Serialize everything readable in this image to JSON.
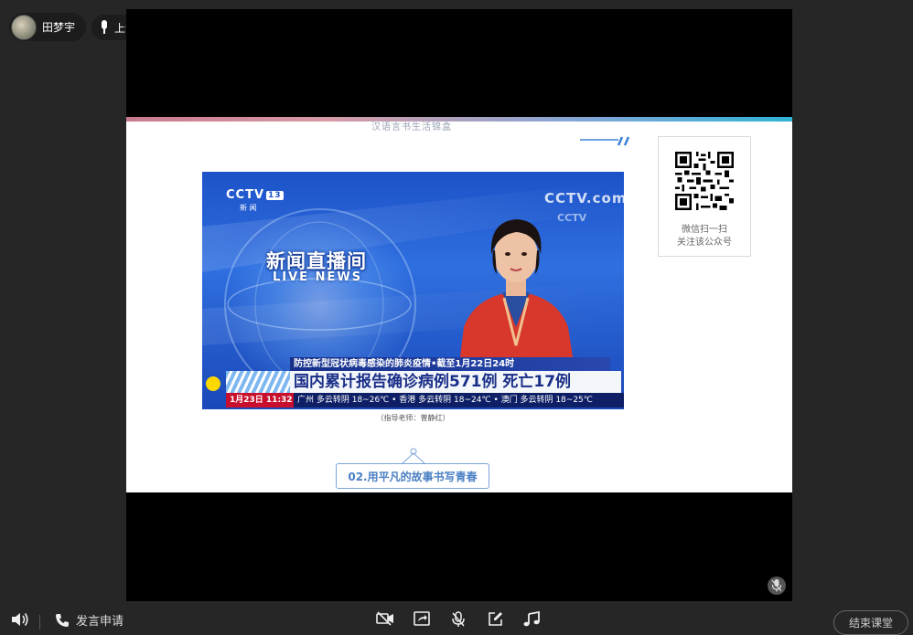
{
  "user": {
    "name": "田梦宇"
  },
  "status": {
    "label": "上课中"
  },
  "slide": {
    "cut_heading": "汉语言书生活锦盒",
    "qr": {
      "line1": "微信扫一扫",
      "line2": "关注该公众号"
    },
    "video": {
      "channel_logo": "CCTV",
      "channel_number": "13",
      "channel_sub": "新 闻",
      "program_title": "新闻直播间",
      "program_subtitle": "LIVE NEWS",
      "watermark": "CCTV.com",
      "watermark2": "CCTV",
      "ticker_top": "防控新型冠状病毒感染的肺炎疫情•截至1月22日24时",
      "ticker_main": "国内累计报告确诊病例571例 死亡17例",
      "ticker_date": "1月23日 11:32",
      "ticker_weather": "广州 多云转阴 18~26℃ • 香港 多云转阴 18~24℃ • 澳门 多云转阴 18~25℃"
    },
    "video_caption": "（指导老师：曾静红）",
    "section_tag": "02.用平凡的故事书写青春"
  },
  "toolbar": {
    "apply_speak_label": "发言申请",
    "end_class_label": "结束课堂"
  },
  "icons": {
    "volume": "speaker-icon",
    "phone": "phone-icon",
    "camera": "camera-off-icon",
    "share": "screen-share-icon",
    "mic": "microphone-icon",
    "edit": "edit-icon",
    "music": "music-icon"
  },
  "colors": {
    "background": "#262626",
    "stage": "#000000",
    "accent_blue": "#4a7fc4",
    "ticker_red": "#c8102e"
  }
}
